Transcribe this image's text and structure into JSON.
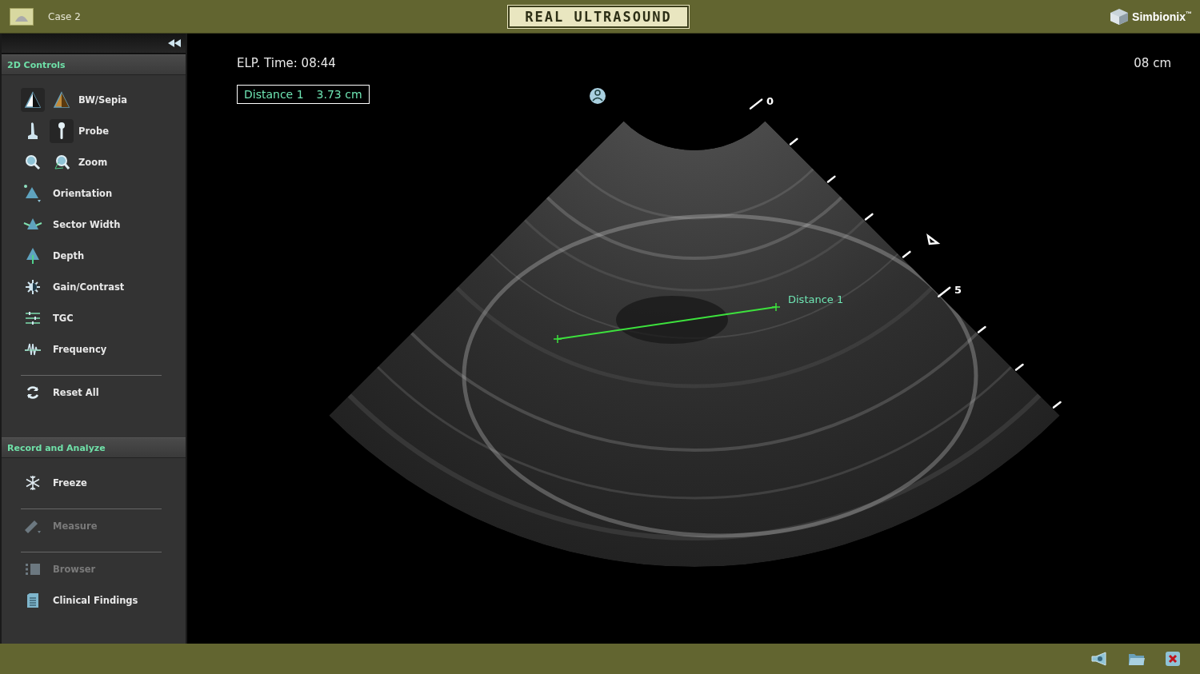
{
  "header": {
    "case_title": "Case 2",
    "logo_text": "REAL ULTRASOUND",
    "brand": "Simbionix$^{™}$"
  },
  "sidebar": {
    "sections": [
      {
        "title": "2D Controls",
        "items": [
          {
            "kind": "pair",
            "label": "BW/Sepia",
            "disabled": false,
            "divider_after": false,
            "options": [
              {
                "selected": true
              },
              {
                "selected": false
              }
            ]
          },
          {
            "kind": "pair",
            "label": "Probe",
            "disabled": false,
            "divider_after": false,
            "options": [
              {
                "selected": false
              },
              {
                "selected": true
              }
            ]
          },
          {
            "kind": "pair",
            "label": "Zoom",
            "disabled": false,
            "divider_after": false,
            "options": [
              {
                "selected": false
              },
              {
                "selected": false
              }
            ]
          },
          {
            "kind": "single",
            "label": "Orientation",
            "disabled": false,
            "divider_after": false
          },
          {
            "kind": "single",
            "label": "Sector Width",
            "disabled": false,
            "divider_after": false
          },
          {
            "kind": "single",
            "label": "Depth",
            "disabled": false,
            "divider_after": false
          },
          {
            "kind": "single",
            "label": "Gain/Contrast",
            "disabled": false,
            "divider_after": false
          },
          {
            "kind": "single",
            "label": "TGC",
            "disabled": false,
            "divider_after": false
          },
          {
            "kind": "single",
            "label": "Frequency",
            "disabled": false,
            "divider_after": true
          },
          {
            "kind": "single",
            "label": "Reset All",
            "disabled": false,
            "divider_after": false
          }
        ]
      },
      {
        "title": "Record and Analyze",
        "items": [
          {
            "kind": "single",
            "label": "Freeze",
            "disabled": false,
            "divider_after": true
          },
          {
            "kind": "single",
            "label": "Measure",
            "disabled": true,
            "divider_after": true
          },
          {
            "kind": "single",
            "label": "Browser",
            "disabled": true,
            "divider_after": false
          },
          {
            "kind": "single",
            "label": "Clinical Findings",
            "disabled": false,
            "divider_after": false
          }
        ]
      }
    ]
  },
  "viewer": {
    "elapsed_time": "ELP. Time: 08:44",
    "depth": "08 cm",
    "measurement": {
      "label": "Distance 1",
      "value": "3.73 cm"
    },
    "scale_labels": [
      "0",
      "5"
    ],
    "caliper_label": "Distance 1"
  }
}
